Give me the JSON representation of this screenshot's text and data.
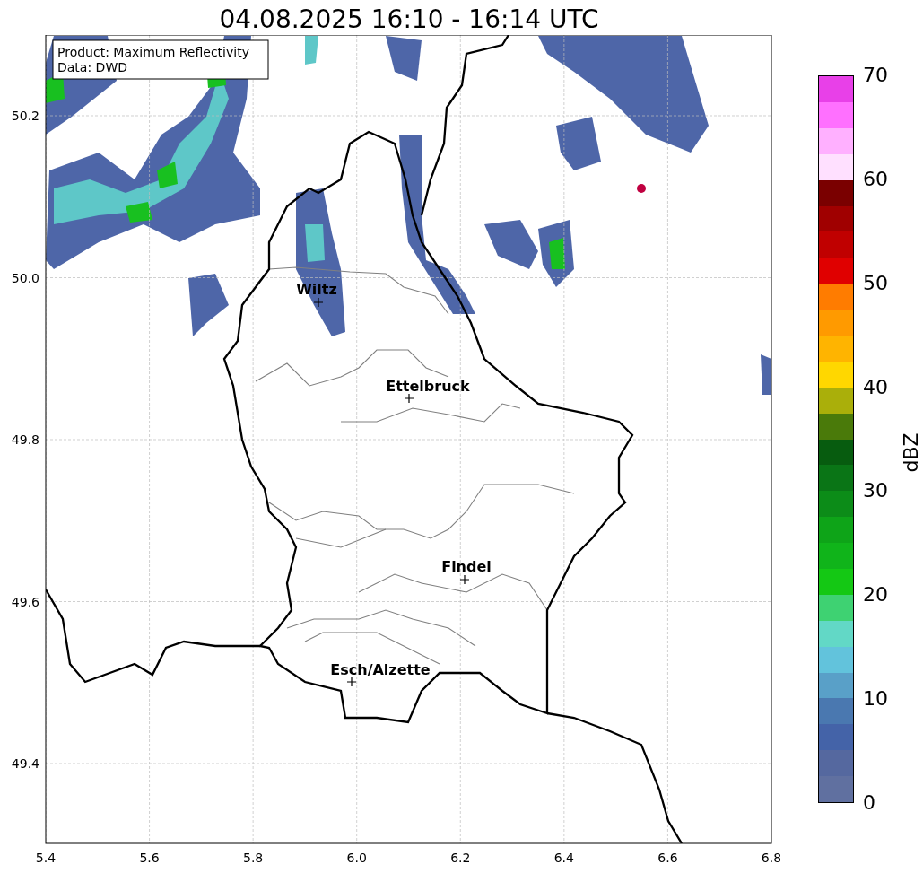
{
  "title": "04.08.2025 16:10 - 16:14 UTC",
  "info_box": [
    "Product: Maximum Reflectivity",
    "Data: DWD"
  ],
  "map": {
    "cities": [
      {
        "name": "Wiltz"
      },
      {
        "name": "Ettelbruck"
      },
      {
        "name": "Findel"
      },
      {
        "name": "Esch/Alzette"
      }
    ],
    "x_ticks": [
      "5.4",
      "5.6",
      "5.8",
      "6.0",
      "6.2",
      "6.4",
      "6.6",
      "6.8"
    ],
    "y_ticks": [
      "50.2",
      "50.0",
      "49.8",
      "49.6",
      "49.4"
    ]
  },
  "colorbar": {
    "label": "dBZ",
    "ticks": [
      "70",
      "60",
      "50",
      "40",
      "30",
      "20",
      "10",
      "0"
    ]
  }
}
